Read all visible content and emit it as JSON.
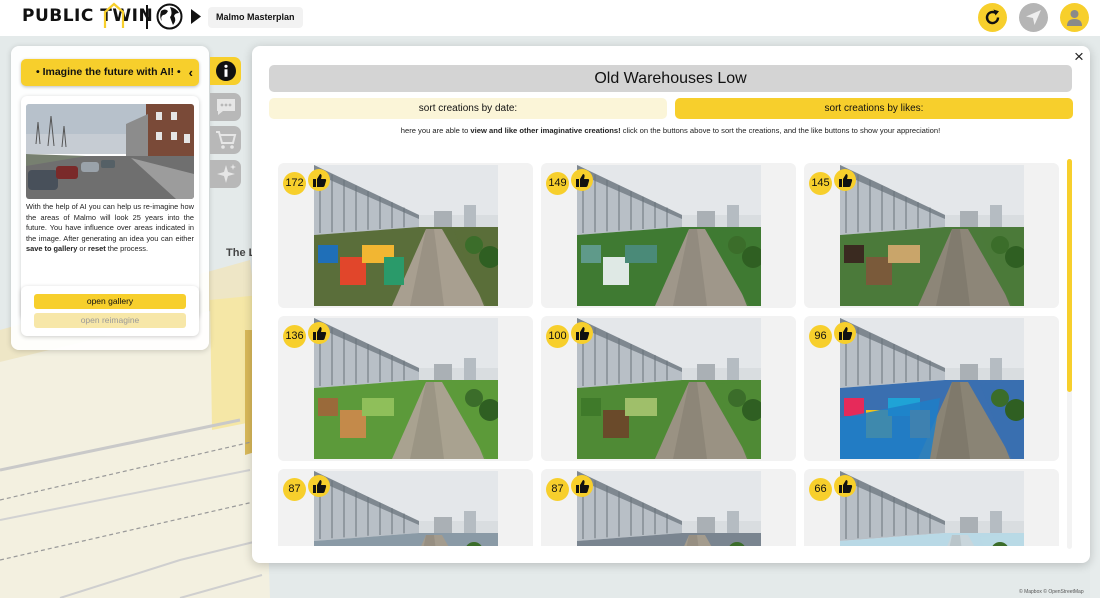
{
  "app": {
    "logo": "PUBLIC TWIN",
    "project": "Malmo Masterplan"
  },
  "left_panel": {
    "banner": "• Imagine the future with AI! •",
    "info_pre": "With the help of AI you can help us re-imagine how the areas of Malmo will look 25 years into the future. You have influence over areas indicated in the image. After generating an idea you can either ",
    "info_bold1": "save to gallery",
    "info_mid": " or ",
    "info_bold2": "reset",
    "info_post": " the process.",
    "open_gallery": "open gallery",
    "open_reimagine": "open reimagine"
  },
  "map": {
    "label": "The Lo",
    "attribution": "© Mapbox © OpenStreetMap"
  },
  "modal": {
    "title": "Old Warehouses Low",
    "sort_by_date": "sort creations by date:",
    "sort_by_likes": "sort creations by likes:",
    "instructions_pre": "here you are able to ",
    "instructions_bold": "view and like other imaginative creations!",
    "instructions_post": " click on the buttons above to sort the creations, and the like buttons to show your appreciation!",
    "close": "×"
  },
  "gallery": [
    {
      "likes": "172",
      "scene": "mural"
    },
    {
      "likes": "149",
      "scene": "market"
    },
    {
      "likes": "145",
      "scene": "cafe"
    },
    {
      "likes": "136",
      "scene": "terrace"
    },
    {
      "likes": "100",
      "scene": "pavilions"
    },
    {
      "likes": "96",
      "scene": "pool"
    },
    {
      "likes": "87",
      "scene": "awning-blue"
    },
    {
      "likes": "87",
      "scene": "awning-dark"
    },
    {
      "likes": "66",
      "scene": "rink"
    }
  ],
  "colors": {
    "accent": "#f7cf2c",
    "accent_light": "#fbf5d8",
    "inactive": "#b8b8b8",
    "map_water": "#dfe7e7",
    "map_land": "#f4f1e2"
  },
  "icons": {
    "info": "info-icon",
    "chat": "chat-icon",
    "cart": "cart-icon",
    "magic": "sparkles-icon",
    "refresh": "refresh-icon",
    "locate": "navigation-arrow-icon",
    "user": "user-icon",
    "like": "thumbs-up-icon",
    "globe": "globe-icon",
    "play": "play-triangle-icon",
    "close": "close-icon"
  }
}
